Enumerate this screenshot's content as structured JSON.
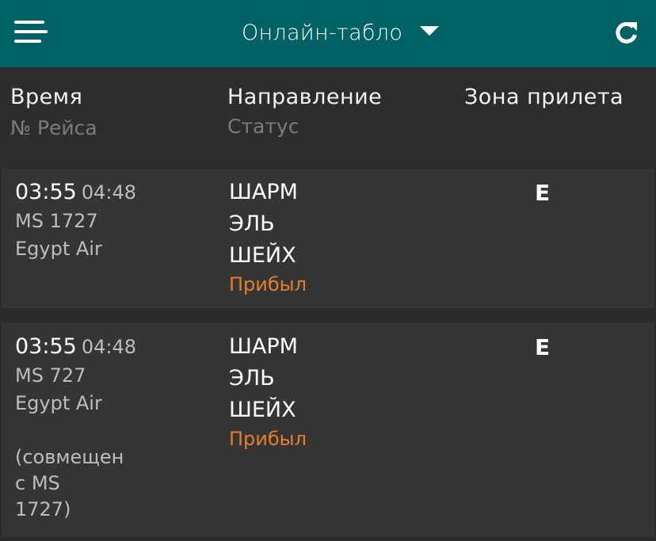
{
  "topbar": {
    "title": "Онлайн-табло",
    "menu_icon": "hamburger-menu-icon",
    "dropdown_icon": "caret-down-icon",
    "refresh_icon": "refresh-icon",
    "bg_color": "#016266"
  },
  "columns": {
    "time": "Время",
    "flight_no": "№ Рейса",
    "direction": "Направление",
    "status": "Статус",
    "zone": "Зона прилета"
  },
  "flights": [
    {
      "scheduled": "03:55",
      "estimated": "04:48",
      "flight_no": "MS 1727",
      "airline": "Egypt Air",
      "dest_lines": [
        "ШАРМ",
        "ЭЛЬ",
        "ШЕЙХ"
      ],
      "status": "Прибыл",
      "zone": "E"
    },
    {
      "scheduled": "03:55",
      "estimated": "04:48",
      "flight_no": "MS 727",
      "airline": "Egypt Air",
      "dest_lines": [
        "ШАРМ",
        "ЭЛЬ",
        "ШЕЙХ"
      ],
      "status": "Прибыл",
      "zone": "E",
      "note_lines": [
        "(совмещен",
        "с MS",
        "1727)"
      ]
    }
  ],
  "colors": {
    "status_arrived": "#e67d2c",
    "background": "#2b2b2b",
    "row_background": "#353535"
  }
}
